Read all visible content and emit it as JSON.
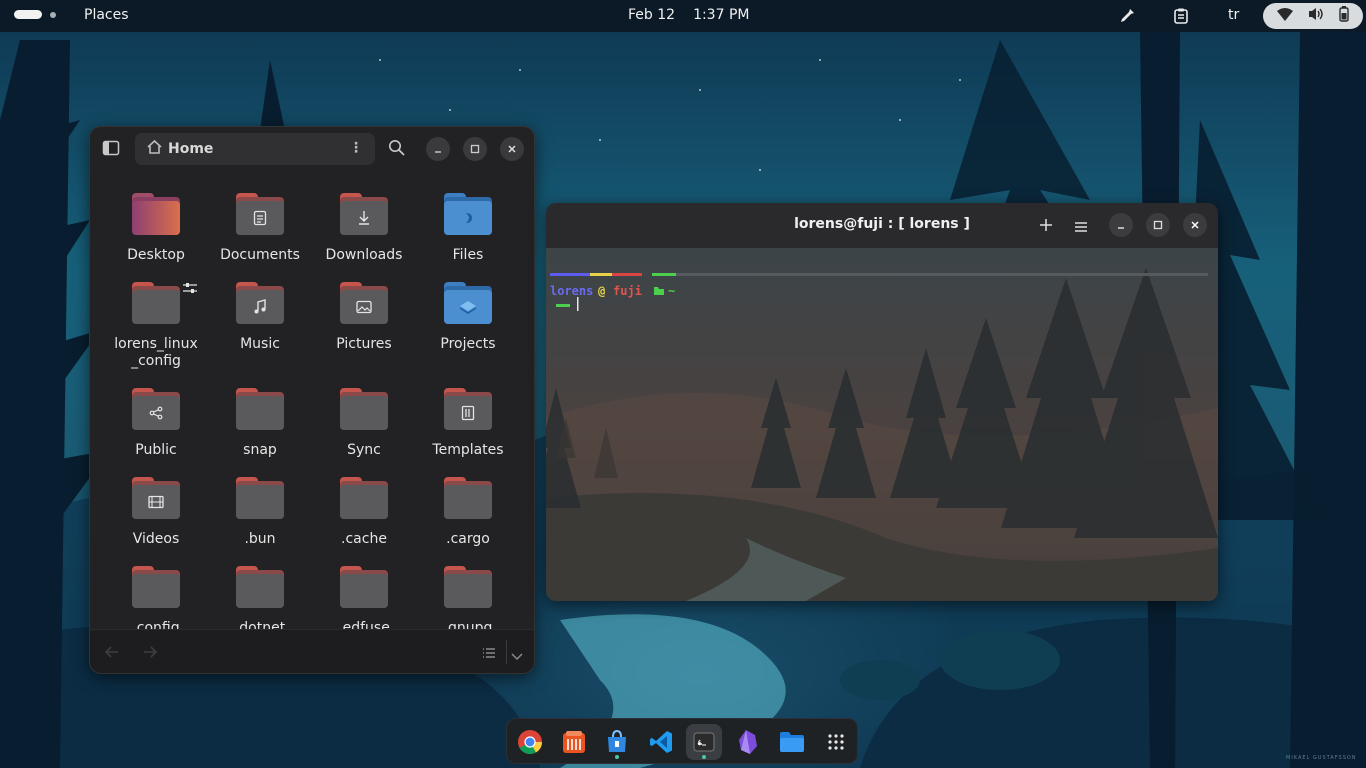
{
  "topbar": {
    "places_label": "Places",
    "date": "Feb 12",
    "time": "1:37 PM",
    "language": "tr",
    "icons": [
      "color-picker-icon",
      "clipboard-icon",
      "wifi-icon",
      "volume-icon",
      "battery-icon"
    ]
  },
  "file_manager": {
    "path_label": "Home",
    "items": [
      {
        "label": "Desktop",
        "kind": "desktop"
      },
      {
        "label": "Documents",
        "kind": "documents"
      },
      {
        "label": "Downloads",
        "kind": "downloads"
      },
      {
        "label": "Files",
        "kind": "files"
      },
      {
        "label": "lorens_linux\n_config",
        "kind": "link"
      },
      {
        "label": "Music",
        "kind": "music"
      },
      {
        "label": "Pictures",
        "kind": "pictures"
      },
      {
        "label": "Projects",
        "kind": "projects"
      },
      {
        "label": "Public",
        "kind": "public"
      },
      {
        "label": "snap",
        "kind": "plain"
      },
      {
        "label": "Sync",
        "kind": "plain"
      },
      {
        "label": "Templates",
        "kind": "templates"
      },
      {
        "label": "Videos",
        "kind": "videos"
      },
      {
        "label": ".bun",
        "kind": "plain"
      },
      {
        "label": ".cache",
        "kind": "plain"
      },
      {
        "label": ".cargo",
        "kind": "plain"
      },
      {
        "label": ".config",
        "kind": "plain"
      },
      {
        "label": ".dotnet",
        "kind": "plain"
      },
      {
        "label": ".edfuse",
        "kind": "plain"
      },
      {
        "label": ".gnupg",
        "kind": "plain"
      }
    ]
  },
  "terminal": {
    "title": "lorens@fuji : [ lorens ]",
    "prompt_user": "lorens",
    "prompt_at": "@",
    "prompt_host": "fuji",
    "prompt_dir": "~"
  },
  "dock": {
    "apps": [
      "chrome-icon",
      "app-center-icon",
      "software-store-icon",
      "vscode-icon",
      "terminal-icon",
      "obsidian-icon",
      "files-icon",
      "app-grid-icon"
    ]
  },
  "wallpaper_credit": "MIKAEL GUSTAFSSON"
}
